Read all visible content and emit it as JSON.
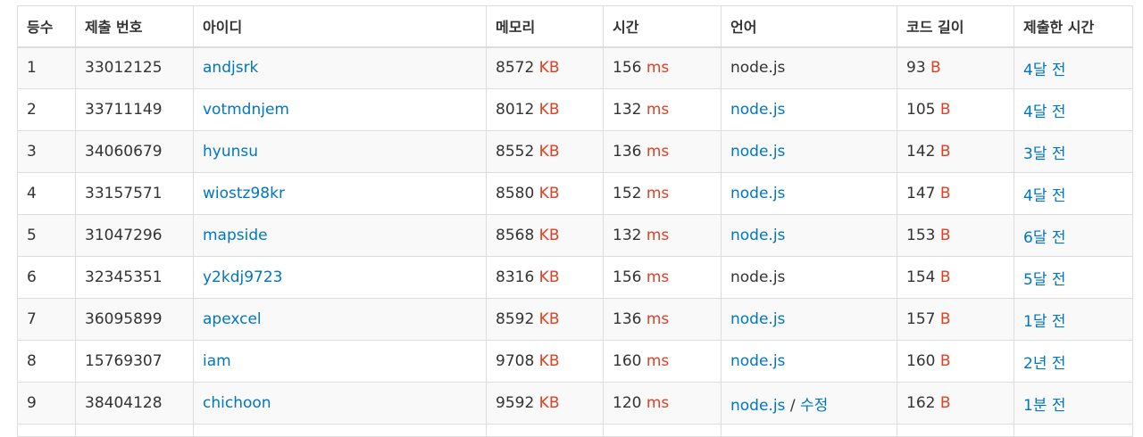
{
  "columns": [
    "등수",
    "제출 번호",
    "아이디",
    "메모리",
    "시간",
    "언어",
    "코드 길이",
    "제출한 시간"
  ],
  "units": {
    "memory": "KB",
    "time": "ms",
    "code": "B"
  },
  "colors": {
    "link": "#0076c0",
    "unit": "#dd4124",
    "text": "#333333",
    "border": "#dddddd",
    "stripe": "#f9f9f9"
  },
  "rows": [
    {
      "rank": "1",
      "submission": "33012125",
      "user": "andjsrk",
      "memory": "8572",
      "time": "156",
      "lang": "node.js",
      "lang_link": false,
      "edit": "",
      "code": "93",
      "submitted": "4달 전"
    },
    {
      "rank": "2",
      "submission": "33711149",
      "user": "votmdnjem",
      "memory": "8012",
      "time": "132",
      "lang": "node.js",
      "lang_link": true,
      "edit": "",
      "code": "105",
      "submitted": "4달 전"
    },
    {
      "rank": "3",
      "submission": "34060679",
      "user": "hyunsu",
      "memory": "8552",
      "time": "136",
      "lang": "node.js",
      "lang_link": true,
      "edit": "",
      "code": "142",
      "submitted": "3달 전"
    },
    {
      "rank": "4",
      "submission": "33157571",
      "user": "wiostz98kr",
      "memory": "8580",
      "time": "152",
      "lang": "node.js",
      "lang_link": true,
      "edit": "",
      "code": "147",
      "submitted": "4달 전"
    },
    {
      "rank": "5",
      "submission": "31047296",
      "user": "mapside",
      "memory": "8568",
      "time": "132",
      "lang": "node.js",
      "lang_link": true,
      "edit": "",
      "code": "153",
      "submitted": "6달 전"
    },
    {
      "rank": "6",
      "submission": "32345351",
      "user": "y2kdj9723",
      "memory": "8316",
      "time": "156",
      "lang": "node.js",
      "lang_link": false,
      "edit": "",
      "code": "154",
      "submitted": "5달 전"
    },
    {
      "rank": "7",
      "submission": "36095899",
      "user": "apexcel",
      "memory": "8592",
      "time": "136",
      "lang": "node.js",
      "lang_link": true,
      "edit": "",
      "code": "157",
      "submitted": "1달 전"
    },
    {
      "rank": "8",
      "submission": "15769307",
      "user": "iam",
      "memory": "9708",
      "time": "160",
      "lang": "node.js",
      "lang_link": true,
      "edit": "",
      "code": "160",
      "submitted": "2년 전"
    },
    {
      "rank": "9",
      "submission": "38404128",
      "user": "chichoon",
      "memory": "9592",
      "time": "120",
      "lang": "node.js",
      "lang_link": true,
      "edit": "수정",
      "code": "162",
      "submitted": "1분 전"
    }
  ]
}
